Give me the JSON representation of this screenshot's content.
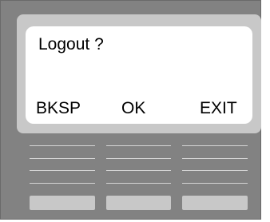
{
  "display": {
    "prompt": "Logout ?",
    "softkeys": [
      "BKSP",
      "OK",
      "EXIT"
    ]
  },
  "colors": {
    "housing": "#828282",
    "bezel": "#c8c8c8",
    "screen": "#ffffff",
    "keys": "#c8c8c8",
    "rule_lines": "#d4d4d4"
  }
}
